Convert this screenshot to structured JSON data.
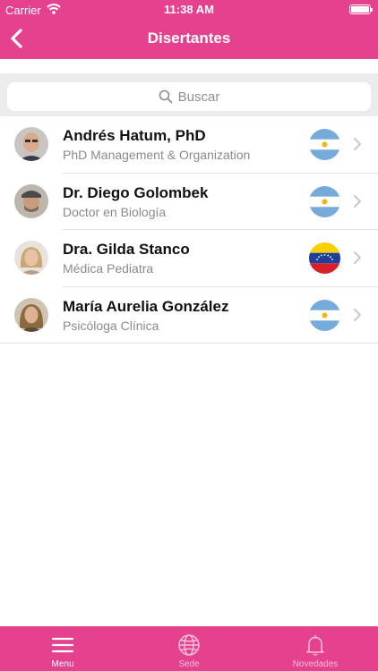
{
  "status_bar": {
    "carrier": "Carrier",
    "time": "11:38 AM"
  },
  "nav": {
    "title": "Disertantes"
  },
  "search": {
    "placeholder": "Buscar"
  },
  "speakers": [
    {
      "name": "Andrés Hatum, PhD",
      "subtitle": "PhD Management & Organization",
      "country": "Argentina"
    },
    {
      "name": "Dr. Diego Golombek",
      "subtitle": "Doctor en Biología",
      "country": "Argentina"
    },
    {
      "name": "Dra. Gilda Stanco",
      "subtitle": "Médica Pediatra",
      "country": "Venezuela"
    },
    {
      "name": "María Aurelia González",
      "subtitle": "Psicóloga Clínica",
      "country": "Argentina"
    }
  ],
  "tabs": [
    {
      "label": "Menu",
      "icon": "menu-icon",
      "active": true
    },
    {
      "label": "Sede",
      "icon": "globe-icon",
      "active": false
    },
    {
      "label": "Novedades",
      "icon": "bell-icon",
      "active": false
    }
  ],
  "colors": {
    "brand": "#e5418f",
    "argentina_blue": "#75aadb",
    "sun": "#f6b40e"
  }
}
